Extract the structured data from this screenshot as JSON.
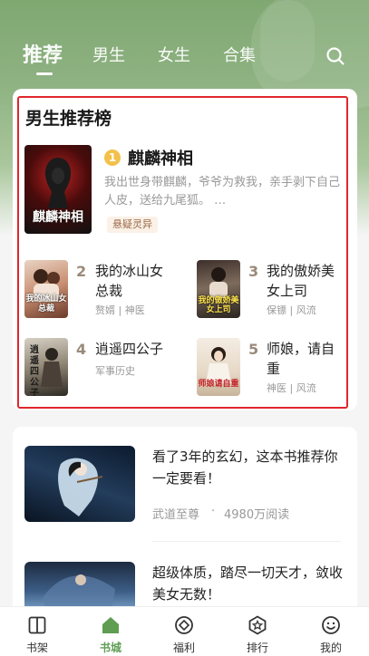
{
  "top_tabs": [
    {
      "label": "推荐",
      "active": true
    },
    {
      "label": "男生",
      "active": false
    },
    {
      "label": "女生",
      "active": false
    },
    {
      "label": "合集",
      "active": false
    }
  ],
  "search_icon": "search-icon",
  "ranking": {
    "title": "男生推荐榜",
    "top": {
      "rank": "1",
      "title": "麒麟神相",
      "description": "我出世身带麒麟，爷爷为救我，亲手剥下自己人皮，送给九尾狐。 …",
      "tag": "悬疑灵异",
      "cover_text": "麒麟神相"
    },
    "items": [
      {
        "rank": "2",
        "title": "我的冰山女总裁",
        "tags": "赘婿 | 神医",
        "cover_text": "我的冰山女总裁"
      },
      {
        "rank": "3",
        "title": "我的傲娇美女上司",
        "tags": "保镖 | 风流",
        "cover_text": "我的傲娇美女上司"
      },
      {
        "rank": "4",
        "title": "逍遥四公子",
        "tags": "军事历史",
        "cover_text": "逍遥四公子"
      },
      {
        "rank": "5",
        "title": "师娘，请自重",
        "tags": "神医 | 风流",
        "cover_text": "师娘请自重"
      }
    ]
  },
  "articles": [
    {
      "title": "看了3年的玄幻，这本书推荐你一定要看！",
      "book": "武道至尊",
      "separator": "·",
      "reads": "4980万阅读"
    },
    {
      "title": "超级体质，踏尽一切天才，敛收美女无数！"
    }
  ],
  "bottom_nav": [
    {
      "label": "书架",
      "icon": "bookshelf-icon",
      "active": false
    },
    {
      "label": "书城",
      "icon": "bookstore-icon",
      "active": true
    },
    {
      "label": "福利",
      "icon": "welfare-icon",
      "active": false
    },
    {
      "label": "排行",
      "icon": "ranking-icon",
      "active": false
    },
    {
      "label": "我的",
      "icon": "profile-icon",
      "active": false
    }
  ],
  "colors": {
    "accent": "#5f9d52",
    "header": "#7fa871",
    "highlight_border": "#e0262c"
  }
}
